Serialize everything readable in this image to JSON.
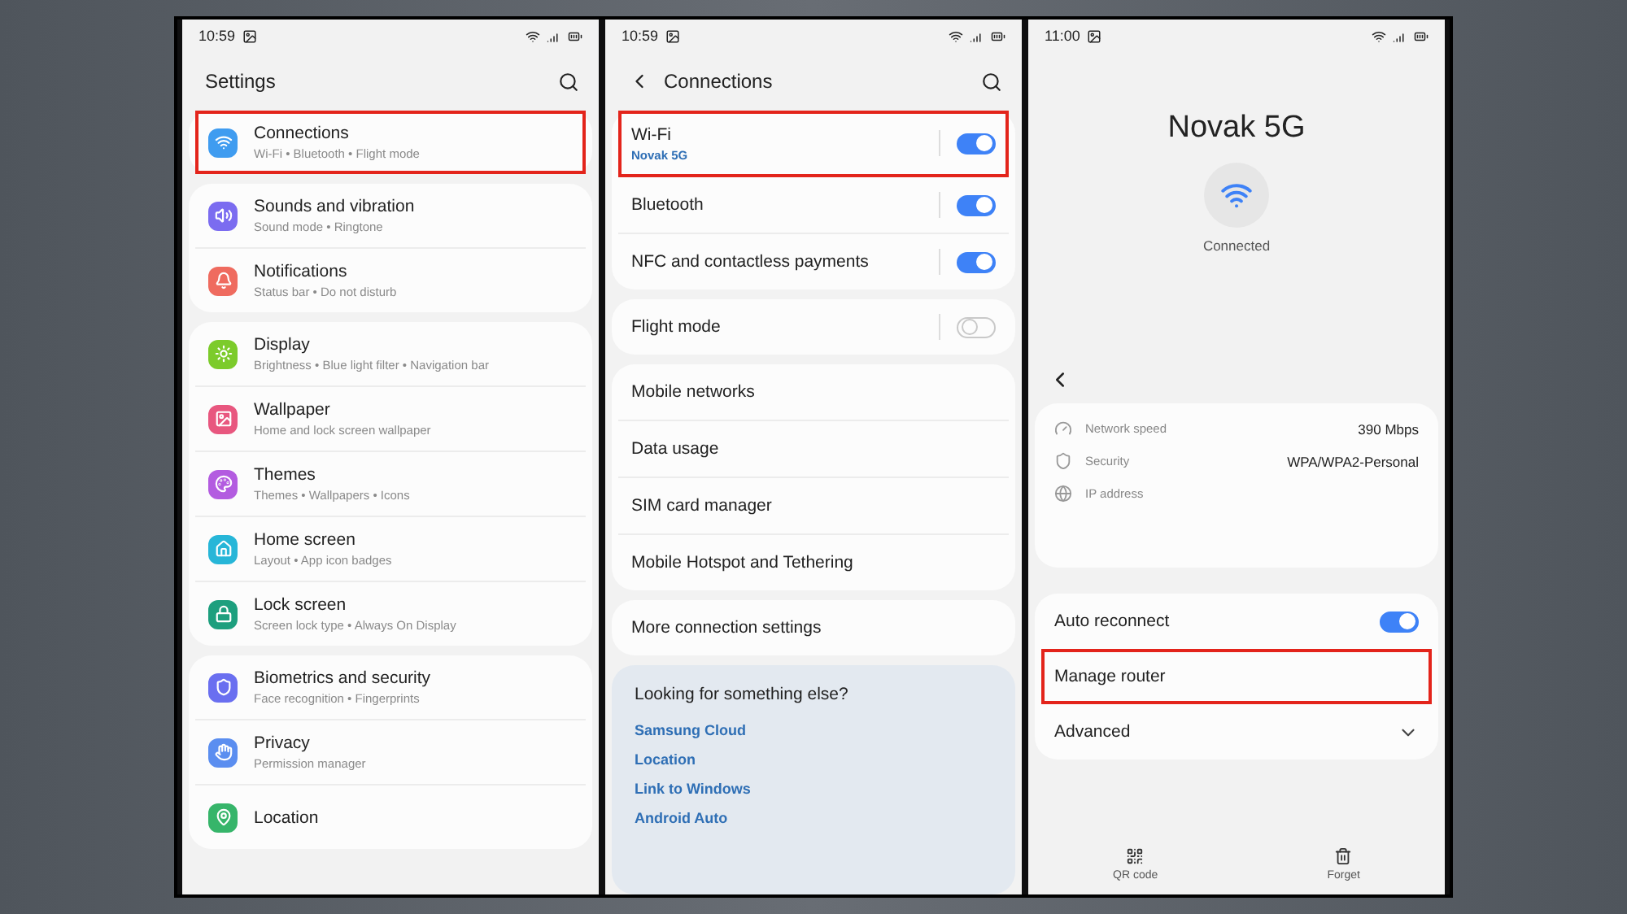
{
  "settings_screen": {
    "time": "10:59",
    "title": "Settings",
    "groups": [
      [
        {
          "title": "Connections",
          "subtitle": "Wi-Fi  •  Bluetooth  •  Flight mode",
          "color": "#3f9cf0",
          "highlighted": true
        }
      ],
      [
        {
          "title": "Sounds and vibration",
          "subtitle": "Sound mode  •  Ringtone",
          "color": "#7b6cf0",
          "highlighted": false
        },
        {
          "title": "Notifications",
          "subtitle": "Status bar  •  Do not disturb",
          "color": "#ef6b5f",
          "highlighted": false
        }
      ],
      [
        {
          "title": "Display",
          "subtitle": "Brightness  •  Blue light filter  •  Navigation bar",
          "color": "#7ccb2b",
          "highlighted": false
        },
        {
          "title": "Wallpaper",
          "subtitle": "Home and lock screen wallpaper",
          "color": "#e8577f",
          "highlighted": false
        },
        {
          "title": "Themes",
          "subtitle": "Themes  •  Wallpapers  •  Icons",
          "color": "#b35ce0",
          "highlighted": false
        },
        {
          "title": "Home screen",
          "subtitle": "Layout  •  App icon badges",
          "color": "#27b6d8",
          "highlighted": false
        },
        {
          "title": "Lock screen",
          "subtitle": "Screen lock type  •  Always On Display",
          "color": "#1d9f7e",
          "highlighted": false
        }
      ],
      [
        {
          "title": "Biometrics and security",
          "subtitle": "Face recognition  •  Fingerprints",
          "color": "#6a6ff0",
          "highlighted": false
        },
        {
          "title": "Privacy",
          "subtitle": "Permission manager",
          "color": "#5b8ef0",
          "highlighted": false
        },
        {
          "title": "Location",
          "color": "#36b56a",
          "highlighted": false
        }
      ]
    ]
  },
  "connections_screen": {
    "time": "10:59",
    "title": "Connections",
    "groups": [
      [
        {
          "kind": "toggle",
          "label": "Wi-Fi",
          "sublabel": "Novak 5G",
          "on": true,
          "highlighted": true
        },
        {
          "kind": "toggle",
          "label": "Bluetooth",
          "on": true,
          "highlighted": false
        },
        {
          "kind": "toggle",
          "label": "NFC and contactless payments",
          "on": true,
          "highlighted": false
        }
      ],
      [
        {
          "kind": "toggle",
          "label": "Flight mode",
          "on": false,
          "highlighted": false
        }
      ],
      [
        {
          "kind": "link",
          "label": "Mobile networks",
          "highlighted": false
        },
        {
          "kind": "link",
          "label": "Data usage",
          "highlighted": false
        },
        {
          "kind": "link",
          "label": "SIM card manager",
          "highlighted": false
        },
        {
          "kind": "link",
          "label": "Mobile Hotspot and Tethering",
          "highlighted": false
        }
      ],
      [
        {
          "kind": "link",
          "label": "More connection settings",
          "highlighted": false
        }
      ]
    ],
    "suggestions": {
      "heading": "Looking for something else?",
      "links": [
        "Samsung Cloud",
        "Location",
        "Link to Windows",
        "Android Auto"
      ]
    }
  },
  "wifi_details_screen": {
    "time": "11:00",
    "network": "Novak 5G",
    "status": "Connected",
    "info": [
      {
        "label": "Network speed",
        "value": "390 Mbps"
      },
      {
        "label": "Security",
        "value": "WPA/WPA2-Personal"
      },
      {
        "label": "IP address"
      }
    ],
    "options": [
      {
        "kind": "toggle",
        "label": "Auto reconnect",
        "on": true,
        "highlighted": false
      },
      {
        "kind": "link",
        "label": "Manage router",
        "highlighted": true
      },
      {
        "kind": "expander",
        "label": "Advanced",
        "expanded": false,
        "highlighted": false
      }
    ],
    "actions": [
      {
        "label": "QR code"
      },
      {
        "label": "Forget"
      }
    ]
  }
}
